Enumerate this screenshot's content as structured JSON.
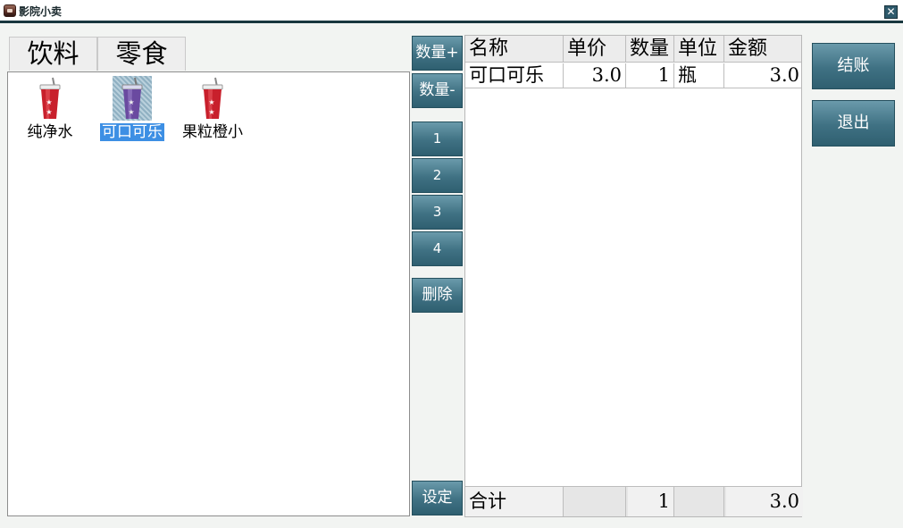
{
  "window": {
    "title": "影院小卖",
    "close_symbol": "✕"
  },
  "categories": [
    {
      "label": "饮料"
    },
    {
      "label": "零食"
    }
  ],
  "products": [
    {
      "name": "纯净水",
      "icon": "drink-cup-icon",
      "selected": false
    },
    {
      "name": "可口可乐",
      "icon": "drink-cup-icon",
      "selected": true
    },
    {
      "name": "果粒橙小",
      "icon": "drink-cup-icon",
      "selected": false
    }
  ],
  "controls": {
    "qty_plus": "数量+",
    "qty_minus": "数量-",
    "num_1": "1",
    "num_2": "2",
    "num_3": "3",
    "num_4": "4",
    "delete": "删除",
    "settings": "设定"
  },
  "order": {
    "columns": [
      "名称",
      "单价",
      "数量",
      "单位",
      "金额"
    ],
    "rows": [
      {
        "name": "可口可乐",
        "price": "3.0",
        "qty": "1",
        "unit": "瓶",
        "amount": "3.0"
      }
    ],
    "total": {
      "label": "合计",
      "qty": "1",
      "amount": "3.0"
    }
  },
  "actions": {
    "checkout": "结账",
    "exit": "退出"
  },
  "colors": {
    "button_top": "#6a9aab",
    "button_bottom": "#2f5f70",
    "selection": "#3d8fe4",
    "cup_red": "#c8202c",
    "cup_purple": "#6a4aa0"
  }
}
